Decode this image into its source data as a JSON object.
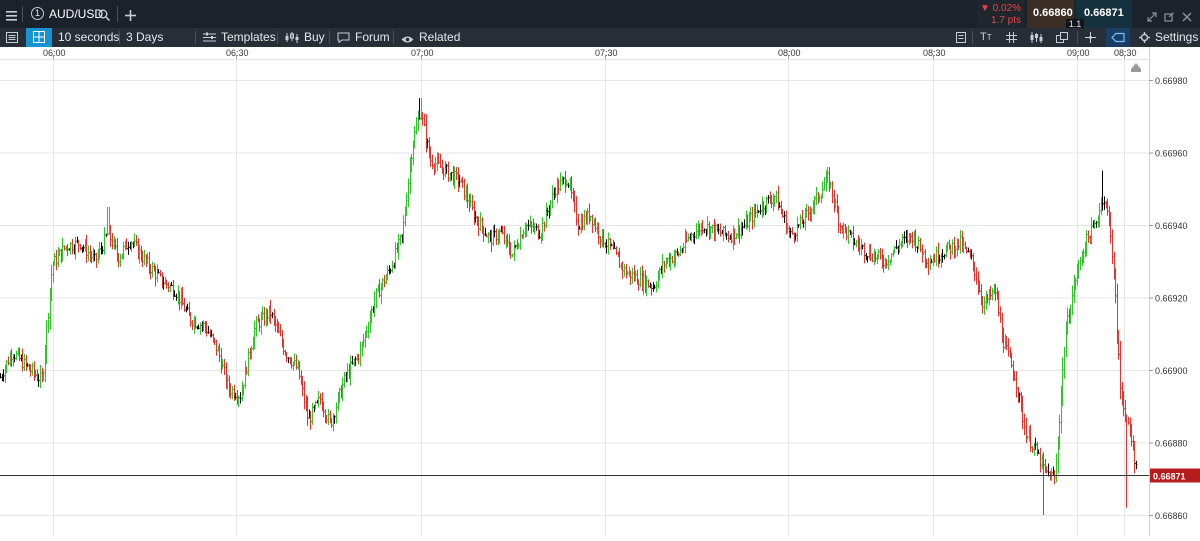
{
  "top_bar": {
    "menu_icon": "hamburger-menu-icon",
    "slot_number": "1",
    "instrument": "AUD/USD",
    "change_pct": "▼ 0.02%",
    "change_pts": "1.7 pts",
    "sell_price": "0.66860",
    "buy_price": "0.66871",
    "spread": "1.1",
    "colors": {
      "bar_bg": "#1b222b",
      "down": "#e8434b",
      "sell_bg": "#3a2e25",
      "buy_bg": "#15303f"
    }
  },
  "toolbar": {
    "interval": "10 seconds",
    "range": "3 Days",
    "templates": "Templates",
    "buy": "Buy",
    "forum": "Forum",
    "related": "Related",
    "settings": "Settings"
  },
  "chart_data": {
    "type": "candlestick",
    "instrument": "AUD/USD",
    "interval": "10 seconds",
    "x_ticks": [
      "06:00",
      "06:30",
      "07:00",
      "07:30",
      "08:00",
      "08:30",
      "09:00",
      "08:30"
    ],
    "y_ticks": [
      "0.66980",
      "0.66960",
      "0.66940",
      "0.66920",
      "0.66900",
      "0.66880",
      "0.66860"
    ],
    "ylim": [
      0.66854,
      0.66993
    ],
    "current_price_label": "0.66871",
    "current_price": 0.66871,
    "grid": true,
    "colors": {
      "up": "#2fc42a",
      "down": "#e5322b",
      "neutral": "#000000",
      "price_tag": "#b71c1c"
    },
    "close_path": [
      [
        0,
        0.66898
      ],
      [
        12,
        0.66905
      ],
      [
        30,
        0.669
      ],
      [
        42,
        0.66897
      ],
      [
        52,
        0.66929
      ],
      [
        65,
        0.66934
      ],
      [
        80,
        0.66935
      ],
      [
        95,
        0.6693
      ],
      [
        108,
        0.66938
      ],
      [
        118,
        0.66931
      ],
      [
        130,
        0.66936
      ],
      [
        145,
        0.6693
      ],
      [
        160,
        0.66925
      ],
      [
        175,
        0.66922
      ],
      [
        190,
        0.66914
      ],
      [
        205,
        0.66912
      ],
      [
        218,
        0.66905
      ],
      [
        228,
        0.66895
      ],
      [
        240,
        0.66893
      ],
      [
        255,
        0.66912
      ],
      [
        270,
        0.66916
      ],
      [
        285,
        0.66905
      ],
      [
        298,
        0.669
      ],
      [
        308,
        0.66886
      ],
      [
        320,
        0.66892
      ],
      [
        330,
        0.66885
      ],
      [
        345,
        0.66898
      ],
      [
        360,
        0.66905
      ],
      [
        375,
        0.6692
      ],
      [
        390,
        0.66928
      ],
      [
        402,
        0.66937
      ],
      [
        412,
        0.66962
      ],
      [
        420,
        0.66972
      ],
      [
        430,
        0.66958
      ],
      [
        445,
        0.66955
      ],
      [
        460,
        0.66952
      ],
      [
        475,
        0.66942
      ],
      [
        490,
        0.66936
      ],
      [
        500,
        0.66938
      ],
      [
        512,
        0.66932
      ],
      [
        525,
        0.6694
      ],
      [
        540,
        0.66938
      ],
      [
        555,
        0.6695
      ],
      [
        567,
        0.66953
      ],
      [
        578,
        0.6694
      ],
      [
        590,
        0.66943
      ],
      [
        600,
        0.66937
      ],
      [
        612,
        0.66933
      ],
      [
        625,
        0.66927
      ],
      [
        640,
        0.66925
      ],
      [
        653,
        0.66923
      ],
      [
        665,
        0.6693
      ],
      [
        678,
        0.66932
      ],
      [
        690,
        0.66937
      ],
      [
        703,
        0.6694
      ],
      [
        718,
        0.66938
      ],
      [
        730,
        0.66937
      ],
      [
        745,
        0.6694
      ],
      [
        760,
        0.66945
      ],
      [
        775,
        0.66948
      ],
      [
        790,
        0.66937
      ],
      [
        805,
        0.66942
      ],
      [
        818,
        0.66948
      ],
      [
        828,
        0.66953
      ],
      [
        840,
        0.6694
      ],
      [
        855,
        0.66935
      ],
      [
        870,
        0.66932
      ],
      [
        885,
        0.6693
      ],
      [
        900,
        0.66935
      ],
      [
        912,
        0.66937
      ],
      [
        928,
        0.6693
      ],
      [
        945,
        0.66933
      ],
      [
        960,
        0.66935
      ],
      [
        972,
        0.6693
      ],
      [
        983,
        0.66918
      ],
      [
        995,
        0.66922
      ],
      [
        1003,
        0.66908
      ],
      [
        1015,
        0.66898
      ],
      [
        1025,
        0.66883
      ],
      [
        1035,
        0.66878
      ],
      [
        1045,
        0.66872
      ],
      [
        1055,
        0.6687
      ],
      [
        1065,
        0.6691
      ],
      [
        1075,
        0.66925
      ],
      [
        1085,
        0.66935
      ],
      [
        1095,
        0.6694
      ],
      [
        1103,
        0.66948
      ],
      [
        1110,
        0.6694
      ],
      [
        1115,
        0.6692
      ],
      [
        1120,
        0.66895
      ],
      [
        1127,
        0.66885
      ],
      [
        1133,
        0.66878
      ],
      [
        1137,
        0.66871
      ]
    ],
    "wick_extremes": [
      {
        "x": 420,
        "high": 0.66975
      },
      {
        "x": 1043,
        "low": 0.6686
      },
      {
        "x": 1103,
        "high": 0.66955
      },
      {
        "x": 1127,
        "low": 0.66862
      },
      {
        "x": 828,
        "high": 0.66956
      },
      {
        "x": 108,
        "high": 0.66945
      }
    ]
  }
}
